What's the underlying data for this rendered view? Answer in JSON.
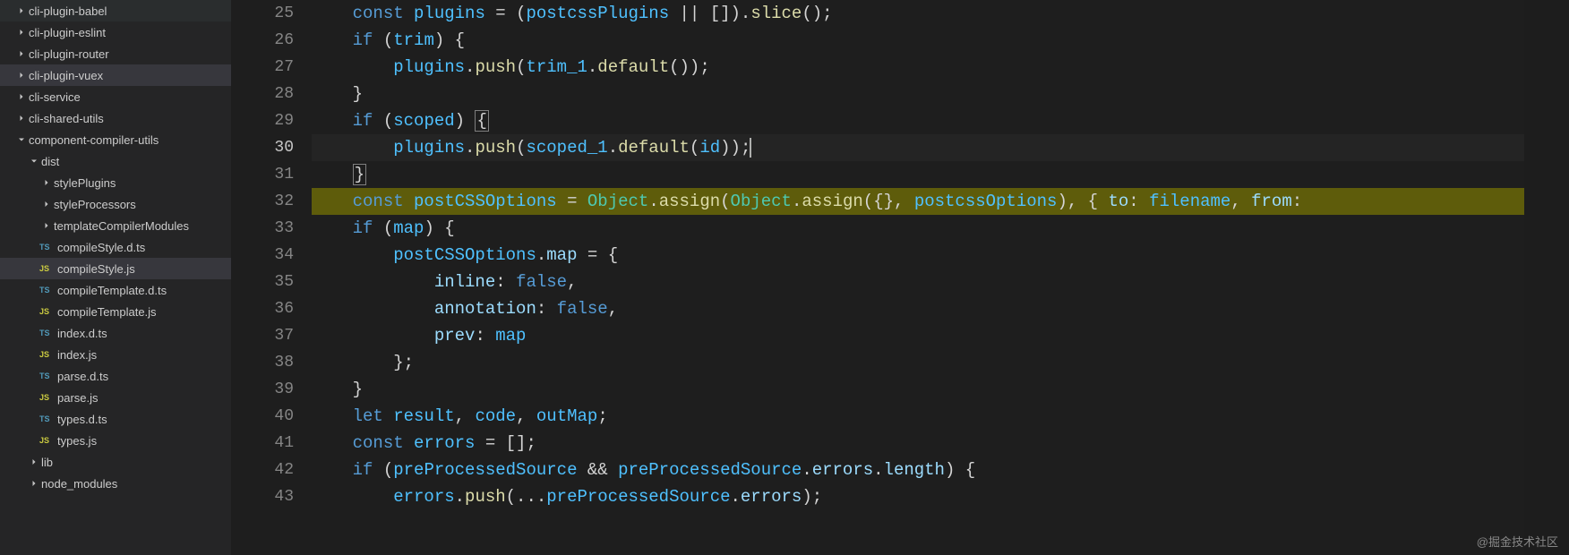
{
  "sidebar": {
    "items": [
      {
        "label": "cli-plugin-babel",
        "type": "folder",
        "expanded": false,
        "indent": 0
      },
      {
        "label": "cli-plugin-eslint",
        "type": "folder",
        "expanded": false,
        "indent": 0
      },
      {
        "label": "cli-plugin-router",
        "type": "folder",
        "expanded": false,
        "indent": 0
      },
      {
        "label": "cli-plugin-vuex",
        "type": "folder",
        "expanded": false,
        "indent": 0,
        "selected": true
      },
      {
        "label": "cli-service",
        "type": "folder",
        "expanded": false,
        "indent": 0
      },
      {
        "label": "cli-shared-utils",
        "type": "folder",
        "expanded": false,
        "indent": 0
      },
      {
        "label": "component-compiler-utils",
        "type": "folder",
        "expanded": true,
        "indent": 0
      },
      {
        "label": "dist",
        "type": "folder",
        "expanded": true,
        "indent": 1
      },
      {
        "label": "stylePlugins",
        "type": "folder",
        "expanded": false,
        "indent": 2
      },
      {
        "label": "styleProcessors",
        "type": "folder",
        "expanded": false,
        "indent": 2
      },
      {
        "label": "templateCompilerModules",
        "type": "folder",
        "expanded": false,
        "indent": 2
      },
      {
        "label": "compileStyle.d.ts",
        "type": "file",
        "icon": "TS",
        "indent": 3
      },
      {
        "label": "compileStyle.js",
        "type": "file",
        "icon": "JS",
        "indent": 3,
        "selected": true
      },
      {
        "label": "compileTemplate.d.ts",
        "type": "file",
        "icon": "TS",
        "indent": 3
      },
      {
        "label": "compileTemplate.js",
        "type": "file",
        "icon": "JS",
        "indent": 3
      },
      {
        "label": "index.d.ts",
        "type": "file",
        "icon": "TS",
        "indent": 3
      },
      {
        "label": "index.js",
        "type": "file",
        "icon": "JS",
        "indent": 3
      },
      {
        "label": "parse.d.ts",
        "type": "file",
        "icon": "TS",
        "indent": 3
      },
      {
        "label": "parse.js",
        "type": "file",
        "icon": "JS",
        "indent": 3
      },
      {
        "label": "types.d.ts",
        "type": "file",
        "icon": "TS",
        "indent": 3
      },
      {
        "label": "types.js",
        "type": "file",
        "icon": "JS",
        "indent": 3
      },
      {
        "label": "lib",
        "type": "folder",
        "expanded": false,
        "indent": 1
      },
      {
        "label": "node_modules",
        "type": "folder",
        "expanded": false,
        "indent": 1
      }
    ]
  },
  "editor": {
    "startLine": 25,
    "breakpointLine": 32,
    "highlightedLine": 32,
    "currentLine": 30,
    "lines": [
      {
        "n": 25,
        "tokens": [
          [
            "    ",
            ""
          ],
          [
            "const",
            "const"
          ],
          [
            " ",
            ""
          ],
          [
            "plugins",
            "var"
          ],
          [
            " = (",
            ""
          ],
          [
            "postcssPlugins",
            "var"
          ],
          [
            " || []).",
            ""
          ],
          [
            "slice",
            "func"
          ],
          [
            "();",
            ""
          ]
        ]
      },
      {
        "n": 26,
        "tokens": [
          [
            "    ",
            ""
          ],
          [
            "if",
            "keyword"
          ],
          [
            " (",
            ""
          ],
          [
            "trim",
            "var"
          ],
          [
            ") {",
            ""
          ]
        ]
      },
      {
        "n": 27,
        "tokens": [
          [
            "        ",
            ""
          ],
          [
            "plugins",
            "var"
          ],
          [
            ".",
            ""
          ],
          [
            "push",
            "func"
          ],
          [
            "(",
            ""
          ],
          [
            "trim_1",
            "var"
          ],
          [
            ".",
            ""
          ],
          [
            "default",
            "func"
          ],
          [
            "());",
            ""
          ]
        ]
      },
      {
        "n": 28,
        "tokens": [
          [
            "    }",
            ""
          ]
        ]
      },
      {
        "n": 29,
        "tokens": [
          [
            "    ",
            ""
          ],
          [
            "if",
            "keyword"
          ],
          [
            " (",
            ""
          ],
          [
            "scoped",
            "var"
          ],
          [
            ") ",
            ""
          ],
          [
            "{",
            "box"
          ]
        ]
      },
      {
        "n": 30,
        "tokens": [
          [
            "        ",
            ""
          ],
          [
            "plugins",
            "var"
          ],
          [
            ".",
            ""
          ],
          [
            "push",
            "func"
          ],
          [
            "(",
            ""
          ],
          [
            "scoped_1",
            "var"
          ],
          [
            ".",
            ""
          ],
          [
            "default",
            "func"
          ],
          [
            "(",
            ""
          ],
          [
            "id",
            "var"
          ],
          [
            "));",
            ""
          ]
        ]
      },
      {
        "n": 31,
        "tokens": [
          [
            "    ",
            ""
          ],
          [
            "}",
            "box"
          ]
        ]
      },
      {
        "n": 32,
        "tokens": [
          [
            "    ",
            ""
          ],
          [
            "const",
            "const"
          ],
          [
            " ",
            ""
          ],
          [
            "postCSSOptions",
            "var"
          ],
          [
            " = ",
            ""
          ],
          [
            "Object",
            "class"
          ],
          [
            ".",
            ""
          ],
          [
            "assign",
            "func"
          ],
          [
            "(",
            ""
          ],
          [
            "Object",
            "class"
          ],
          [
            ".",
            ""
          ],
          [
            "assign",
            "func"
          ],
          [
            "({}, ",
            ""
          ],
          [
            "postcssOptions",
            "var"
          ],
          [
            "), { ",
            ""
          ],
          [
            "to",
            "prop"
          ],
          [
            ": ",
            ""
          ],
          [
            "filename",
            "var"
          ],
          [
            ", ",
            ""
          ],
          [
            "from",
            "prop"
          ],
          [
            ":",
            ""
          ]
        ]
      },
      {
        "n": 33,
        "tokens": [
          [
            "    ",
            ""
          ],
          [
            "if",
            "keyword"
          ],
          [
            " (",
            ""
          ],
          [
            "map",
            "var"
          ],
          [
            ") {",
            ""
          ]
        ]
      },
      {
        "n": 34,
        "tokens": [
          [
            "        ",
            ""
          ],
          [
            "postCSSOptions",
            "var"
          ],
          [
            ".",
            ""
          ],
          [
            "map",
            "prop"
          ],
          [
            " = {",
            ""
          ]
        ]
      },
      {
        "n": 35,
        "tokens": [
          [
            "            ",
            ""
          ],
          [
            "inline",
            "prop"
          ],
          [
            ": ",
            ""
          ],
          [
            "false",
            "keyword"
          ],
          [
            ",",
            ""
          ]
        ]
      },
      {
        "n": 36,
        "tokens": [
          [
            "            ",
            ""
          ],
          [
            "annotation",
            "prop"
          ],
          [
            ": ",
            ""
          ],
          [
            "false",
            "keyword"
          ],
          [
            ",",
            ""
          ]
        ]
      },
      {
        "n": 37,
        "tokens": [
          [
            "            ",
            ""
          ],
          [
            "prev",
            "prop"
          ],
          [
            ": ",
            ""
          ],
          [
            "map",
            "var"
          ]
        ]
      },
      {
        "n": 38,
        "tokens": [
          [
            "        };",
            ""
          ]
        ]
      },
      {
        "n": 39,
        "tokens": [
          [
            "    }",
            ""
          ]
        ]
      },
      {
        "n": 40,
        "tokens": [
          [
            "    ",
            ""
          ],
          [
            "let",
            "keyword"
          ],
          [
            " ",
            ""
          ],
          [
            "result",
            "var"
          ],
          [
            ", ",
            ""
          ],
          [
            "code",
            "var"
          ],
          [
            ", ",
            ""
          ],
          [
            "outMap",
            "var"
          ],
          [
            ";",
            ""
          ]
        ]
      },
      {
        "n": 41,
        "tokens": [
          [
            "    ",
            ""
          ],
          [
            "const",
            "const"
          ],
          [
            " ",
            ""
          ],
          [
            "errors",
            "var"
          ],
          [
            " = [];",
            ""
          ]
        ]
      },
      {
        "n": 42,
        "tokens": [
          [
            "    ",
            ""
          ],
          [
            "if",
            "keyword"
          ],
          [
            " (",
            ""
          ],
          [
            "preProcessedSource",
            "var"
          ],
          [
            " && ",
            ""
          ],
          [
            "preProcessedSource",
            "var"
          ],
          [
            ".",
            ""
          ],
          [
            "errors",
            "prop"
          ],
          [
            ".",
            ""
          ],
          [
            "length",
            "prop"
          ],
          [
            ") {",
            ""
          ]
        ]
      },
      {
        "n": 43,
        "tokens": [
          [
            "        ",
            ""
          ],
          [
            "errors",
            "var"
          ],
          [
            ".",
            ""
          ],
          [
            "push",
            "func"
          ],
          [
            "(...",
            ""
          ],
          [
            "preProcessedSource",
            "var"
          ],
          [
            ".",
            ""
          ],
          [
            "errors",
            "prop"
          ],
          [
            ");",
            ""
          ]
        ]
      }
    ]
  },
  "watermark": "@掘金技术社区"
}
